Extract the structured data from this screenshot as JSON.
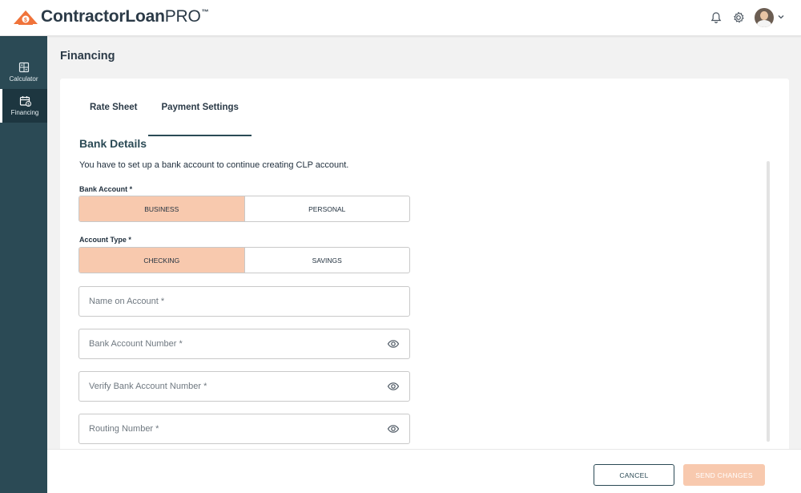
{
  "app": {
    "logo_text": "ContractorLoan",
    "logo_pro": "PRO",
    "logo_tm": "™"
  },
  "header": {
    "icons": [
      "bell-icon",
      "gear-icon",
      "avatar",
      "chevron-down-icon"
    ]
  },
  "sidebar": {
    "items": [
      {
        "label": "Calculator",
        "icon": "calculator-icon",
        "active": false
      },
      {
        "label": "Financing",
        "icon": "calendar-dollar-icon",
        "active": true
      }
    ]
  },
  "page": {
    "title": "Financing"
  },
  "tabs": [
    {
      "label": "Rate Sheet",
      "active": false
    },
    {
      "label": "Payment Settings",
      "active": true
    }
  ],
  "bank_details": {
    "title": "Bank Details",
    "description": "You have to set up a bank account to continue creating CLP account.",
    "bank_account": {
      "label": "Bank Account *",
      "options": [
        "BUSINESS",
        "PERSONAL"
      ],
      "selected": "BUSINESS"
    },
    "account_type": {
      "label": "Account Type *",
      "options": [
        "CHECKING",
        "SAVINGS"
      ],
      "selected": "CHECKING"
    },
    "fields": {
      "name_on_account": {
        "placeholder": "Name on Account *"
      },
      "account_number": {
        "placeholder": "Bank Account Number *"
      },
      "verify_account_number": {
        "placeholder": "Verify Bank Account Number *"
      },
      "routing_number": {
        "placeholder": "Routing Number *"
      }
    }
  },
  "footer": {
    "cancel_label": "CANCEL",
    "send_label": "SEND CHANGES"
  },
  "colors": {
    "brand_orange": "#f0733a",
    "accent_peach": "#f8c9ae",
    "sidebar_bg": "#2b4a55",
    "text_dark": "#2b3a47"
  }
}
